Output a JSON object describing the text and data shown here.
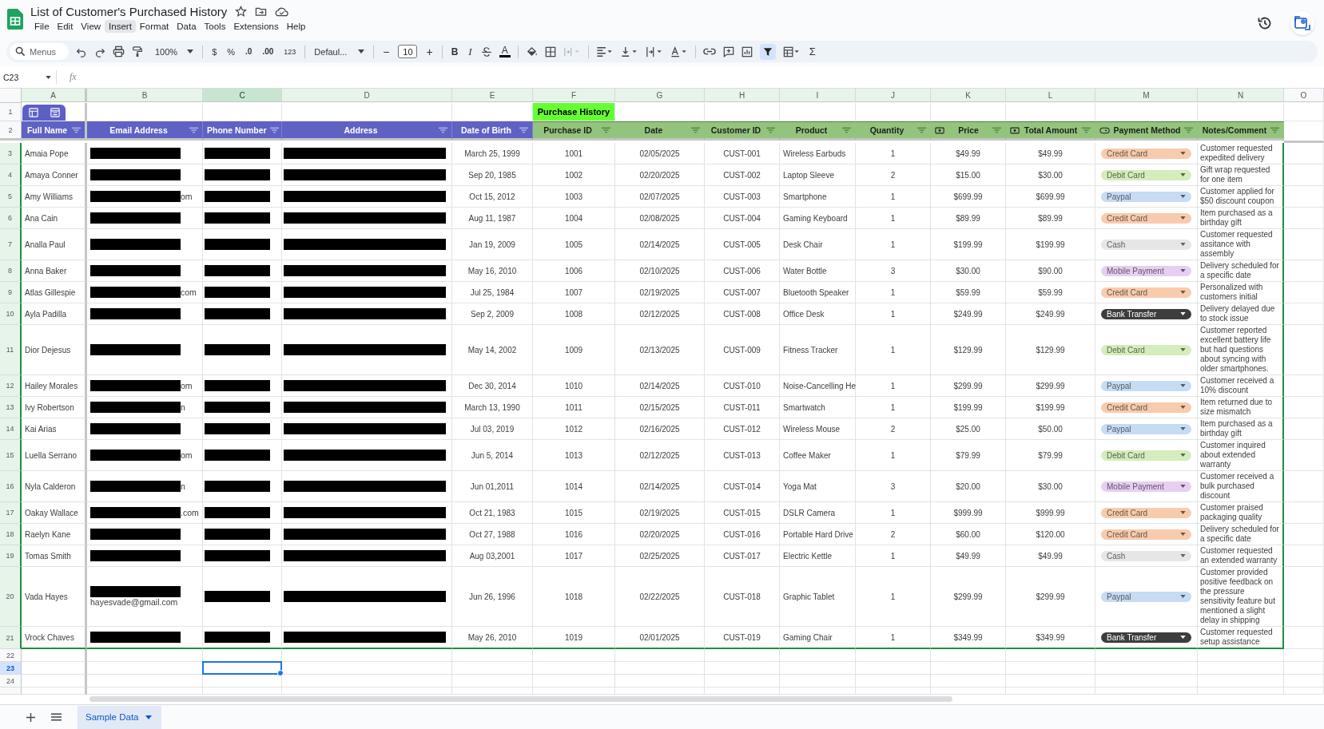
{
  "app": {
    "title": "List of Customer's Purchased History",
    "menus": [
      {
        "label": "File",
        "selected": false
      },
      {
        "label": "Edit",
        "selected": false
      },
      {
        "label": "View",
        "selected": false
      },
      {
        "label": "Insert",
        "selected": true
      },
      {
        "label": "Format",
        "selected": false
      },
      {
        "label": "Data",
        "selected": false
      },
      {
        "label": "Tools",
        "selected": false
      },
      {
        "label": "Extensions",
        "selected": false
      },
      {
        "label": "Help",
        "selected": false
      }
    ]
  },
  "toolbar": {
    "search_placeholder": "Menus",
    "zoom": "100%",
    "currency": "$",
    "percent": "%",
    "decrease_decimal": ".0",
    "increase_decimal": ".00",
    "number_format": "123",
    "font": "Defaul...",
    "minus": "−",
    "font_size": "10",
    "plus": "+",
    "bold": "B",
    "italic": "I",
    "text_color": "A",
    "sum": "Σ"
  },
  "formula_bar": {
    "cell_ref": "C23",
    "fx": "fx"
  },
  "sheet": {
    "columns": [
      {
        "letter": "A",
        "in_table": true,
        "selected": false
      },
      {
        "letter": "B",
        "in_table": true,
        "selected": false
      },
      {
        "letter": "C",
        "in_table": true,
        "selected": true
      },
      {
        "letter": "D",
        "in_table": true,
        "selected": false
      },
      {
        "letter": "E",
        "in_table": true,
        "selected": false
      },
      {
        "letter": "F",
        "in_table": true,
        "selected": false
      },
      {
        "letter": "G",
        "in_table": true,
        "selected": false
      },
      {
        "letter": "H",
        "in_table": true,
        "selected": false
      },
      {
        "letter": "I",
        "in_table": true,
        "selected": false
      },
      {
        "letter": "J",
        "in_table": true,
        "selected": false
      },
      {
        "letter": "K",
        "in_table": true,
        "selected": false
      },
      {
        "letter": "L",
        "in_table": true,
        "selected": false
      },
      {
        "letter": "M",
        "in_table": true,
        "selected": false
      },
      {
        "letter": "N",
        "in_table": true,
        "selected": false
      },
      {
        "letter": "O",
        "in_table": false,
        "selected": false
      }
    ],
    "title_row": {
      "number": "1",
      "label": "Purchase History"
    },
    "header_row": {
      "number": "2",
      "cells": [
        {
          "label": "Full Name",
          "kind": "customer"
        },
        {
          "label": "Email Address",
          "kind": "customer"
        },
        {
          "label": "Phone Number",
          "kind": "customer"
        },
        {
          "label": "Address",
          "kind": "customer"
        },
        {
          "label": "Date of Birth",
          "kind": "customer"
        },
        {
          "label": "Purchase ID",
          "kind": "purchase"
        },
        {
          "label": "Date",
          "kind": "purchase"
        },
        {
          "label": "Customer ID",
          "kind": "purchase"
        },
        {
          "label": "Product",
          "kind": "purchase"
        },
        {
          "label": "Quantity",
          "kind": "purchase"
        },
        {
          "label": "Price",
          "kind": "currency"
        },
        {
          "label": "Total Amount",
          "kind": "currency"
        },
        {
          "label": "Payment Method",
          "kind": "dropdown"
        },
        {
          "label": "Notes/Comment",
          "kind": "purchase"
        }
      ]
    },
    "records": [
      {
        "number": "3",
        "name": "Amaia Pope",
        "birth": "March 25, 1999",
        "purchase_id": "1001",
        "date": "02/05/2025",
        "customer_id": "CUST-001",
        "product": "Wireless Earbuds",
        "quantity": "1",
        "price": "$49.99",
        "total": "$49.99",
        "payment": {
          "label": "Credit Card",
          "color": "#f8cbad"
        },
        "note": "Customer requested expedited delivery"
      },
      {
        "number": "4",
        "name": "Amaya Conner",
        "birth": "Sep 20, 1985",
        "purchase_id": "1002",
        "date": "02/20/2025",
        "customer_id": "CUST-002",
        "product": "Laptop Sleeve",
        "quantity": "2",
        "price": "$15.00",
        "total": "$30.00",
        "payment": {
          "label": "Debit Card",
          "color": "#d4edbc"
        },
        "note": "Gift wrap requested for one item"
      },
      {
        "number": "5",
        "name": "Amy Williams",
        "email_tail": "om",
        "birth": "Oct 15, 2012",
        "purchase_id": "1003",
        "date": "02/07/2025",
        "customer_id": "CUST-003",
        "product": "Smartphone",
        "quantity": "1",
        "price": "$699.99",
        "total": "$699.99",
        "payment": {
          "label": "Paypal",
          "color": "#c6dbf4"
        },
        "note": "Customer applied for $50 discount coupon"
      },
      {
        "number": "6",
        "name": "Ana Cain",
        "birth": "Aug 11, 1987",
        "purchase_id": "1004",
        "date": "02/08/2025",
        "customer_id": "CUST-004",
        "product": "Gaming Keyboard",
        "quantity": "1",
        "price": "$89.99",
        "total": "$89.99",
        "payment": {
          "label": "Credit Card",
          "color": "#f8cbad"
        },
        "note": "Item purchased as a birthday gift"
      },
      {
        "number": "7",
        "name": "Analla Paul",
        "birth": "Jan 19, 2009",
        "purchase_id": "1005",
        "date": "02/14/2025",
        "customer_id": "CUST-005",
        "product": "Desk Chair",
        "quantity": "1",
        "price": "$199.99",
        "total": "$199.99",
        "payment": {
          "label": "Cash",
          "color": "#e6e6e6"
        },
        "note": "Customer requested assitance with assembly"
      },
      {
        "number": "8",
        "name": "Anna Baker",
        "birth": "May 16, 2010",
        "purchase_id": "1006",
        "date": "02/10/2025",
        "customer_id": "CUST-006",
        "product": "Water Bottle",
        "quantity": "3",
        "price": "$30.00",
        "total": "$90.00",
        "payment": {
          "label": "Mobile Payment",
          "color": "#e6cff2"
        },
        "note": "Delivery scheduled for a specific date"
      },
      {
        "number": "9",
        "name": "Atlas Gillespie",
        "email_tail": "com",
        "birth": "Jul 25, 1984",
        "purchase_id": "1007",
        "date": "02/19/2025",
        "customer_id": "CUST-007",
        "product": "Bluetooth Speaker",
        "quantity": "1",
        "price": "$59.99",
        "total": "$59.99",
        "payment": {
          "label": "Credit Card",
          "color": "#f8cbad"
        },
        "note": "Personalized with customers initial"
      },
      {
        "number": "10",
        "name": "Ayla Padilla",
        "birth": "Sep 2, 2009",
        "purchase_id": "1008",
        "date": "02/12/2025",
        "customer_id": "CUST-008",
        "product": "Office Desk",
        "quantity": "1",
        "price": "$249.99",
        "total": "$249.99",
        "payment": {
          "label": "Bank Transfer",
          "color": "#3d3d3d"
        },
        "note": "Delivery delayed due to stock issue"
      },
      {
        "number": "11",
        "name": "Dior Dejesus",
        "birth": "May 14, 2002",
        "purchase_id": "1009",
        "date": "02/13/2025",
        "customer_id": "CUST-009",
        "product": "Fitness Tracker",
        "quantity": "1",
        "price": "$129.99",
        "total": "$129.99",
        "payment": {
          "label": "Debit Card",
          "color": "#d4edbc"
        },
        "note": "Customer reported excellent battery life but had questions about syncing with older smartphones."
      },
      {
        "number": "12",
        "name": "Hailey Morales",
        "email_tail": "om",
        "birth": "Dec 30, 2014",
        "purchase_id": "1010",
        "date": "02/14/2025",
        "customer_id": "CUST-010",
        "product": "Noise-Cancelling He",
        "quantity": "1",
        "price": "$299.99",
        "total": "$299.99",
        "payment": {
          "label": "Paypal",
          "color": "#c6dbf4"
        },
        "note": "Customer received a 10% discount"
      },
      {
        "number": "13",
        "name": "Ivy Robertson",
        "email_tail": "n",
        "birth": "March 13, 1990",
        "purchase_id": "1011",
        "date": "02/15/2025",
        "customer_id": "CUST-011",
        "product": "Smartwatch",
        "quantity": "1",
        "price": "$199.99",
        "total": "$199.99",
        "payment": {
          "label": "Credit Card",
          "color": "#f8cbad"
        },
        "note": "Item returned due to size mismatch"
      },
      {
        "number": "14",
        "name": "Kai Arias",
        "birth": "Jul 03, 2019",
        "purchase_id": "1012",
        "date": "02/16/2025",
        "customer_id": "CUST-012",
        "product": "Wireless Mouse",
        "quantity": "2",
        "price": "$25.00",
        "total": "$50.00",
        "payment": {
          "label": "Paypal",
          "color": "#c6dbf4"
        },
        "note": "Item purchased as a birthday gift"
      },
      {
        "number": "15",
        "name": "Luella Serrano",
        "email_tail": "om",
        "birth": "Jun 5, 2014",
        "purchase_id": "1013",
        "date": "02/12/2025",
        "customer_id": "CUST-013",
        "product": "Coffee Maker",
        "quantity": "1",
        "price": "$79.99",
        "total": "$79.99",
        "payment": {
          "label": "Debit Card",
          "color": "#d4edbc"
        },
        "note": "Customer inquired about extended warranty"
      },
      {
        "number": "16",
        "name": "Nyla Calderon",
        "email_tail": "n",
        "birth": "Jun 01,2011",
        "purchase_id": "1014",
        "date": "02/14/2025",
        "customer_id": "CUST-014",
        "product": "Yoga Mat",
        "quantity": "3",
        "price": "$20.00",
        "total": "$30.00",
        "payment": {
          "label": "Mobile Payment",
          "color": "#e6cff2"
        },
        "note": "Customer received a bulk purchased discount"
      },
      {
        "number": "17",
        "name": "Oakay Wallace",
        "email_tail": ".com",
        "birth": "Oct 21, 1983",
        "purchase_id": "1015",
        "date": "02/19/2025",
        "customer_id": "CUST-015",
        "product": "DSLR Camera",
        "quantity": "1",
        "price": "$999.99",
        "total": "$999.99",
        "payment": {
          "label": "Credit Card",
          "color": "#f8cbad"
        },
        "note": "Customer praised packaging quality"
      },
      {
        "number": "18",
        "name": "Raelyn Kane",
        "birth": "Oct 27, 1988",
        "purchase_id": "1016",
        "date": "02/20/2025",
        "customer_id": "CUST-016",
        "product": "Portable Hard Drive",
        "quantity": "2",
        "price": "$60.00",
        "total": "$120.00",
        "payment": {
          "label": "Credit Card",
          "color": "#f8cbad"
        },
        "note": "Delivery scheduled for a specific date"
      },
      {
        "number": "19",
        "name": "Tomas Smith",
        "birth": "Aug 03,2001",
        "purchase_id": "1017",
        "date": "02/25/2025",
        "customer_id": "CUST-017",
        "product": "Electric Kettle",
        "quantity": "1",
        "price": "$49.99",
        "total": "$49.99",
        "payment": {
          "label": "Cash",
          "color": "#e6e6e6"
        },
        "note": "Customer requested an extended warranty"
      },
      {
        "number": "20",
        "name": "Vada Hayes",
        "email_tail": "hayesvade@gmail.com",
        "birth": "Jun 26, 1996",
        "purchase_id": "1018",
        "date": "02/22/2025",
        "customer_id": "CUST-018",
        "product": "Graphic Tablet",
        "quantity": "1",
        "price": "$299.99",
        "total": "$299.99",
        "payment": {
          "label": "Paypal",
          "color": "#c6dbf4"
        },
        "note": "Customer provided positive feedback on the pressure sensitivity feature but mentioned a slight delay in shipping"
      },
      {
        "number": "21",
        "name": "Vrock Chaves",
        "birth": "May 26, 2010",
        "purchase_id": "1019",
        "date": "02/01/2025",
        "customer_id": "CUST-019",
        "product": "Gaming Chair",
        "quantity": "1",
        "price": "$349.99",
        "total": "$349.99",
        "payment": {
          "label": "Bank Transfer",
          "color": "#3d3d3d"
        },
        "note": "Customer requested setup assistance"
      }
    ],
    "empty_rows": [
      {
        "number": "22",
        "selected": false
      },
      {
        "number": "23",
        "selected": true
      },
      {
        "number": "24",
        "selected": false
      }
    ]
  },
  "tabs": [
    {
      "label": "Sample Data",
      "selected": true
    }
  ]
}
